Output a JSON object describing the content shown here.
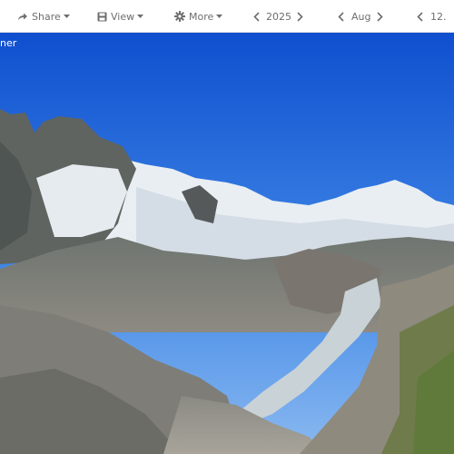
{
  "toolbar": {
    "share_label": "Share",
    "view_label": "View",
    "more_label": "More",
    "year": "2025",
    "month": "Aug",
    "day": "12."
  },
  "photo": {
    "caption": "ner"
  },
  "colors": {
    "toolbar_text": "#6e6e6e",
    "toolbar_bg": "#ffffff",
    "sky_top": "#0f4fcf",
    "sky_bottom": "#7eb2f0"
  }
}
